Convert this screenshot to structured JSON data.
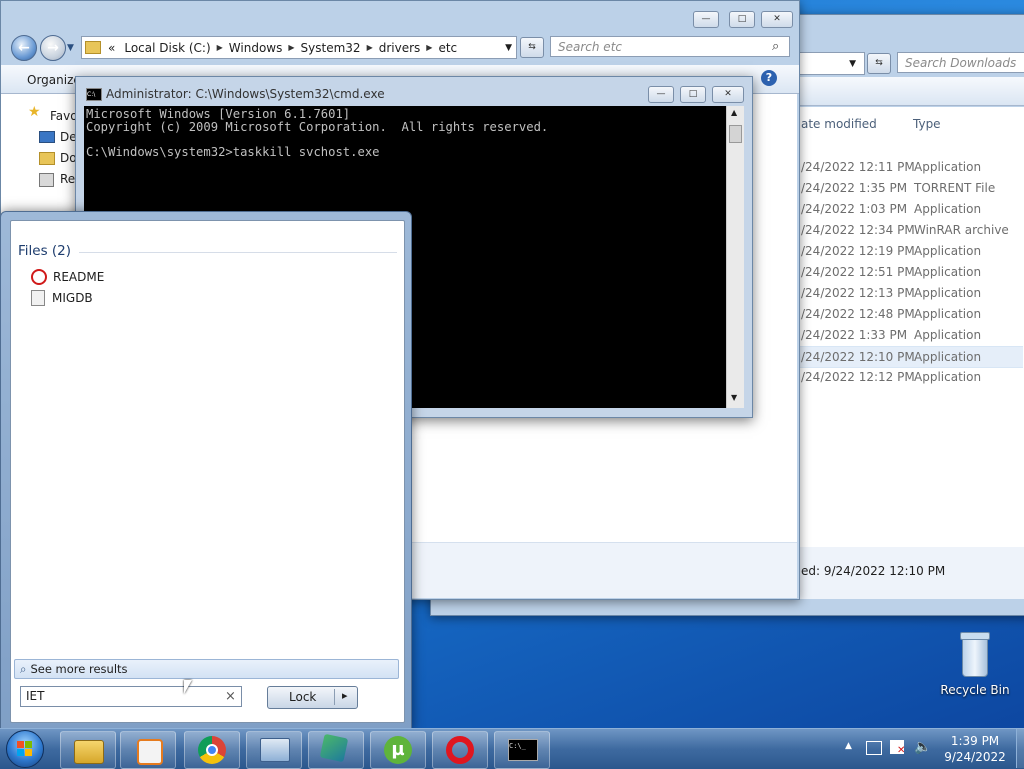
{
  "explorer_back": {
    "address_right": "",
    "search_placeholder": "Search Downloads",
    "columns": {
      "date": "ate modified",
      "type": "Type"
    },
    "rows": [
      {
        "date": "/24/2022 12:11 PM",
        "type": "Application"
      },
      {
        "date": "/24/2022 1:35 PM",
        "type": "TORRENT File"
      },
      {
        "date": "/24/2022 1:03 PM",
        "type": "Application"
      },
      {
        "date": "/24/2022 12:34 PM",
        "type": "WinRAR archive"
      },
      {
        "date": "/24/2022 12:19 PM",
        "type": "Application"
      },
      {
        "date": "/24/2022 12:51 PM",
        "type": "Application"
      },
      {
        "date": "/24/2022 12:13 PM",
        "type": "Application"
      },
      {
        "date": "/24/2022 12:48 PM",
        "type": "Application"
      },
      {
        "date": "/24/2022 1:33 PM",
        "type": "Application"
      },
      {
        "date": "/24/2022 12:10 PM",
        "type": "Application",
        "selected": true
      },
      {
        "date": "/24/2022 12:12 PM",
        "type": "Application"
      }
    ],
    "status": "ed:  9/24/2022 12:10 PM"
  },
  "explorer_front": {
    "breadcrumb": [
      "Local Disk (C:)",
      "Windows",
      "System32",
      "drivers",
      "etc"
    ],
    "breadcrumb_prefix": "«",
    "search_placeholder": "Search etc",
    "organize": "Organize",
    "nav": [
      "Favo",
      "Des",
      "Dov",
      "Rec"
    ]
  },
  "cmd": {
    "title": "Administrator: C:\\Windows\\System32\\cmd.exe",
    "lines": [
      "Microsoft Windows [Version 6.1.7601]",
      "Copyright (c) 2009 Microsoft Corporation.  All rights reserved.",
      "",
      "C:\\Windows\\system32>taskkill svchost.exe"
    ]
  },
  "start_menu": {
    "files_header": "Files (2)",
    "files": [
      {
        "name": "README",
        "icon": "opera-icon"
      },
      {
        "name": "MIGDB",
        "icon": "ini-file-icon"
      }
    ],
    "see_more": "See more results",
    "search_value": "IET",
    "clear": "×",
    "lock": "Lock",
    "lock_arrow": "▸"
  },
  "desktop": {
    "recycle_bin": "Recycle Bin"
  },
  "taskbar": {
    "time": "1:39 PM",
    "date": "9/24/2022",
    "items": [
      "windows-explorer-icon",
      "media-player-icon",
      "chrome-icon",
      "remote-desktop-icon",
      "setup-icon",
      "utorrent-icon",
      "opera-icon",
      "cmd-icon"
    ],
    "cmd_label": "C:\\_"
  },
  "colors": {
    "accent": "#2b8ae0",
    "cmd_bg": "#000000",
    "cmd_text": "#c0c0c0"
  }
}
